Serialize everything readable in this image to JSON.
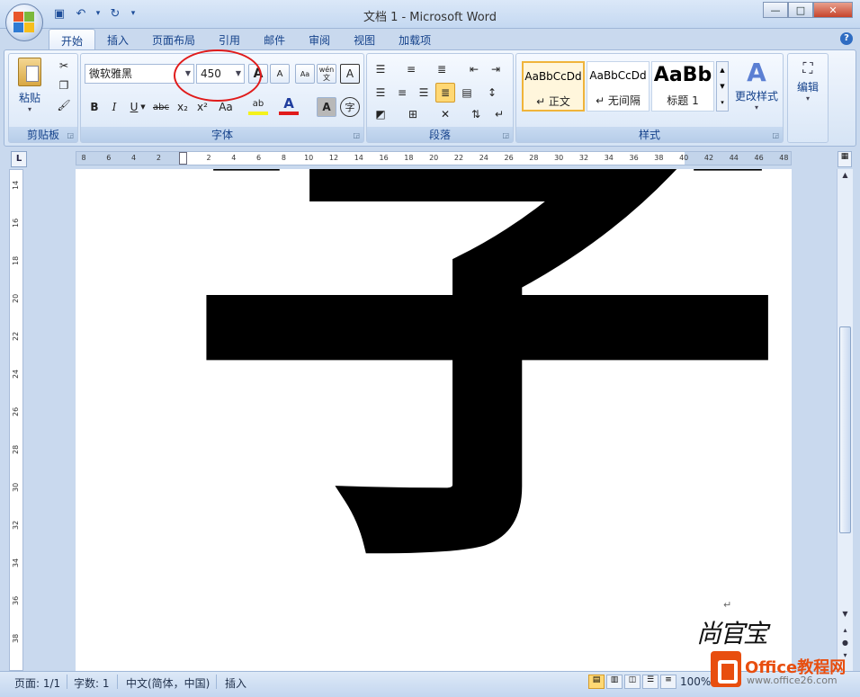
{
  "window": {
    "title": "文档 1 - Microsoft Word",
    "controls": {
      "minimize": "—",
      "maximize": "□",
      "close": "✕"
    }
  },
  "quick_access": [
    {
      "name": "save-icon",
      "glyph": "▣"
    },
    {
      "name": "undo-icon",
      "glyph": "↶"
    },
    {
      "name": "undo-dropdown-icon",
      "glyph": "▾"
    },
    {
      "name": "redo-icon",
      "glyph": "↻"
    },
    {
      "name": "customize-qat-icon",
      "glyph": "▾"
    }
  ],
  "tabs": [
    "开始",
    "插入",
    "页面布局",
    "引用",
    "邮件",
    "审阅",
    "视图",
    "加载项"
  ],
  "active_tab": "开始",
  "ribbon": {
    "clipboard": {
      "label": "剪贴板",
      "paste": "粘贴",
      "paste_arrow": "▾"
    },
    "font": {
      "label": "字体",
      "font_name": "微软雅黑",
      "font_size": "450",
      "grow": "A",
      "shrink": "A",
      "clear": "Aa",
      "phonetic": "wén 文",
      "border": "A",
      "bold": "B",
      "italic": "I",
      "underline": "U",
      "strike": "abc",
      "subscript": "x₂",
      "superscript": "x²",
      "case": "Aa",
      "highlight": "ab",
      "color": "A",
      "shade": "A",
      "enclose": "字"
    },
    "paragraph": {
      "label": "段落"
    },
    "styles": {
      "label": "样式",
      "items": [
        {
          "sample": "AaBbCcDd",
          "name": "↵ 正文",
          "selected": true
        },
        {
          "sample": "AaBbCcDd",
          "name": "↵ 无间隔",
          "selected": false
        },
        {
          "sample": "AaBb",
          "name": "标题 1",
          "selected": false
        }
      ],
      "change": "更改样式",
      "change_arrow": "▾"
    },
    "editing": {
      "label": "编辑",
      "arrow": "▾"
    }
  },
  "ruler": {
    "corner": "L",
    "h_ticks": [
      "8",
      "6",
      "4",
      "2",
      "2",
      "4",
      "6",
      "8",
      "10",
      "12",
      "14",
      "16",
      "18",
      "20",
      "22",
      "24",
      "26",
      "28",
      "30",
      "32",
      "34",
      "36",
      "38",
      "40",
      "42",
      "44",
      "46",
      "48"
    ],
    "v_ticks": [
      "14",
      "16",
      "18",
      "20",
      "22",
      "24",
      "26",
      "28",
      "30",
      "32",
      "34",
      "36",
      "38"
    ]
  },
  "document": {
    "text": "字",
    "paragraph_mark": "↵",
    "signature": "尚官宝"
  },
  "statusbar": {
    "page": "页面: 1/1",
    "words": "字数: 1",
    "language": "中文(简体，中国)",
    "mode": "插入",
    "zoom": "100%"
  },
  "watermark": {
    "brand": "Office教程网",
    "url": "www.office26.com"
  },
  "colors": {
    "accent": "#15428b",
    "highlight_circle": "#e01b1b",
    "selected_style": "#f0b43a"
  }
}
